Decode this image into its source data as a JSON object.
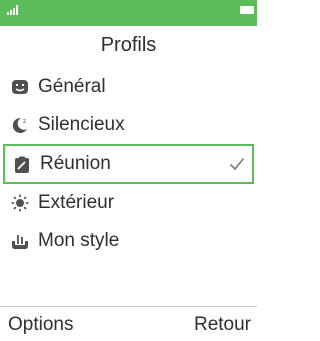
{
  "status_bar": {
    "signal_icon": "signal-icon",
    "battery_icon": "battery-icon",
    "color": "#5dbd5b"
  },
  "header": {
    "title": "Profils"
  },
  "profiles": [
    {
      "label": "Général",
      "icon": "face-icon",
      "selected": false
    },
    {
      "label": "Silencieux",
      "icon": "moon-icon",
      "selected": false
    },
    {
      "label": "Réunion",
      "icon": "clipboard-icon",
      "selected": true
    },
    {
      "label": "Extérieur",
      "icon": "sun-icon",
      "selected": false
    },
    {
      "label": "Mon style",
      "icon": "custom-icon",
      "selected": false
    }
  ],
  "softkeys": {
    "left": "Options",
    "right": "Retour"
  },
  "colors": {
    "accent": "#5dbd5b",
    "icon": "#505050",
    "text": "#2f2f2f"
  }
}
